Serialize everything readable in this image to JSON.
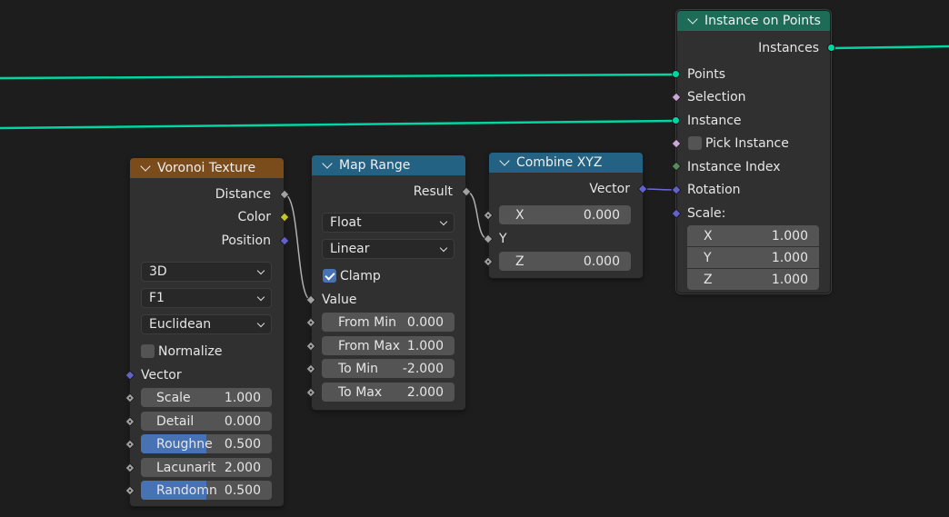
{
  "colors": {
    "background": "#1d1d1d",
    "node_body": "#303030",
    "geometry_link": "#00d6a3",
    "header_texture": "#7a4b1b",
    "header_converter": "#246283",
    "header_geometry": "#1e6c57",
    "socket_float": "#a1a1a1",
    "socket_color": "#c7c729",
    "socket_vector": "#6363c7",
    "socket_bool": "#cca6d6",
    "socket_int": "#598c5c",
    "socket_geometry": "#00d6a3",
    "field_active": "#4772b3"
  },
  "voronoi": {
    "title": "Voronoi Texture",
    "outputs": [
      "Distance",
      "Color",
      "Position"
    ],
    "dimensions": "3D",
    "feature": "F1",
    "metric": "Euclidean",
    "normalize_label": "Normalize",
    "normalize_checked": false,
    "vector_label": "Vector",
    "fields": [
      {
        "label": "Scale",
        "value": "1.000",
        "fill": 0
      },
      {
        "label": "Detail",
        "value": "0.000",
        "fill": 0
      },
      {
        "label": "Roughne",
        "value": "0.500",
        "fill": 0.5
      },
      {
        "label": "Lacunarit",
        "value": "2.000",
        "fill": 0
      },
      {
        "label": "Randomn",
        "value": "0.500",
        "fill": 0.5
      }
    ]
  },
  "map_range": {
    "title": "Map Range",
    "output": "Result",
    "data_type": "Float",
    "interpolation": "Linear",
    "clamp_label": "Clamp",
    "clamp_checked": true,
    "value_label": "Value",
    "fields": [
      {
        "label": "From Min",
        "value": "0.000"
      },
      {
        "label": "From Max",
        "value": "1.000"
      },
      {
        "label": "To Min",
        "value": "-2.000"
      },
      {
        "label": "To Max",
        "value": "2.000"
      }
    ]
  },
  "combine_xyz": {
    "title": "Combine XYZ",
    "output": "Vector",
    "x": {
      "label": "X",
      "value": "0.000"
    },
    "y_label": "Y",
    "z": {
      "label": "Z",
      "value": "0.000"
    }
  },
  "instance_on_points": {
    "title": "Instance on Points",
    "output": "Instances",
    "inputs": {
      "points": "Points",
      "selection": "Selection",
      "instance": "Instance",
      "pick_instance": "Pick Instance",
      "instance_index": "Instance Index",
      "rotation": "Rotation",
      "scale": "Scale:"
    },
    "pick_instance_checked": false,
    "scale": [
      {
        "label": "X",
        "value": "1.000"
      },
      {
        "label": "Y",
        "value": "1.000"
      },
      {
        "label": "Z",
        "value": "1.000"
      }
    ]
  }
}
